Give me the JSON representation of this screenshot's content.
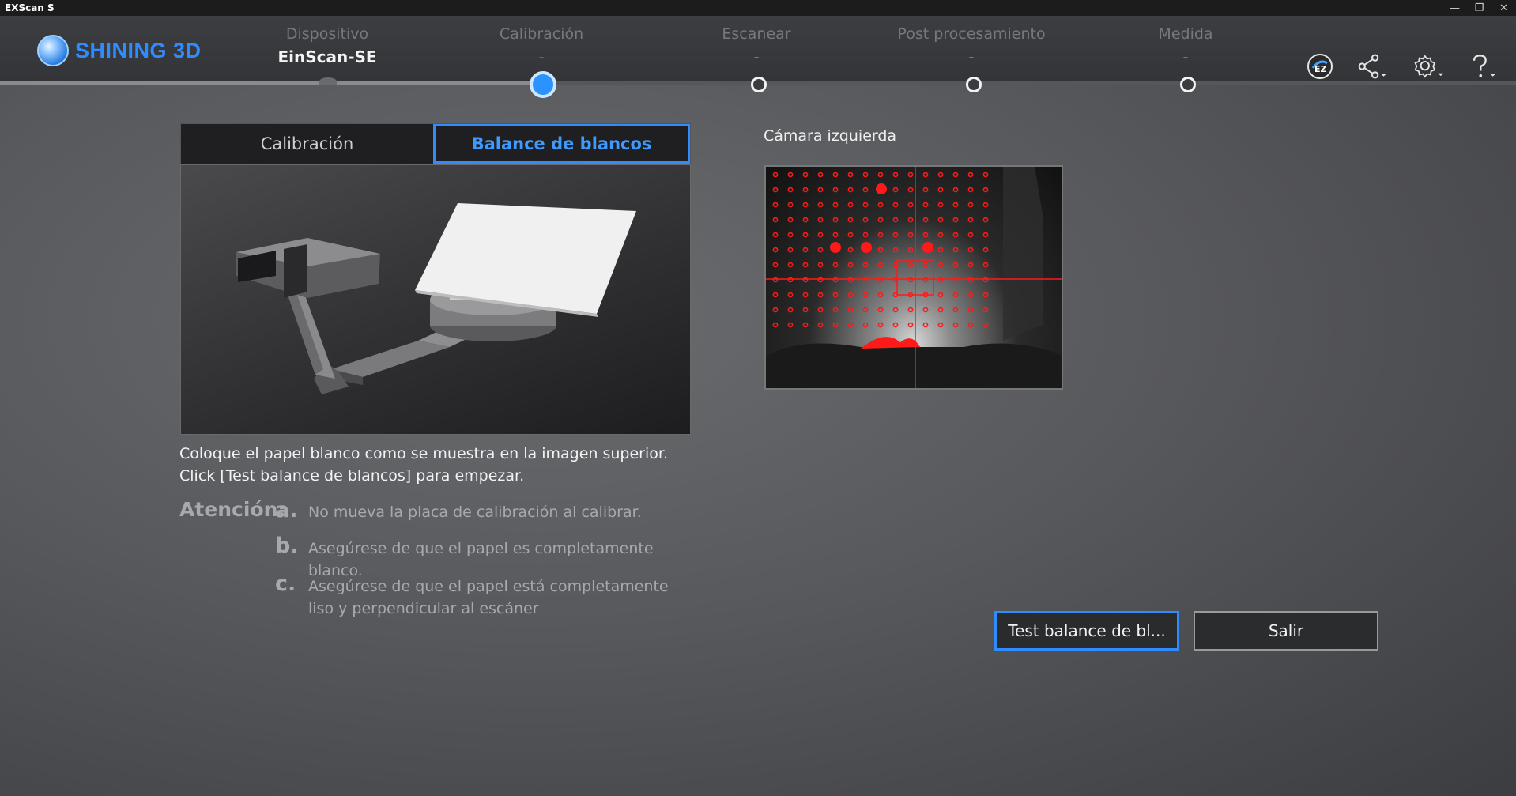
{
  "window": {
    "title": "EXScan S",
    "controls": [
      "minimize",
      "restore",
      "close"
    ]
  },
  "brand": {
    "name": "SHINING 3D"
  },
  "steps": [
    {
      "label": "Dispositivo",
      "value": "EinScan-SE"
    },
    {
      "label": "Calibración",
      "value": "-"
    },
    {
      "label": "Escanear",
      "value": "-"
    },
    {
      "label": "Post procesamiento",
      "value": "-"
    },
    {
      "label": "Medida",
      "value": "-"
    }
  ],
  "header_icons": [
    "ezmodel-icon",
    "share-icon",
    "settings-icon",
    "help-icon"
  ],
  "tabs": [
    {
      "label": "Calibración",
      "active": false
    },
    {
      "label": "Balance de blancos",
      "active": true
    }
  ],
  "instructions": {
    "line1": "Coloque el papel blanco como se muestra en la imagen superior.",
    "line2": "Click [Test balance de blancos] para empezar."
  },
  "attention": {
    "label": "Atención:",
    "items": [
      {
        "letter": "a.",
        "text": "No mueva la placa de calibración al calibrar."
      },
      {
        "letter": "b.",
        "text": "Asegúrese de que el papel es completamente blanco."
      },
      {
        "letter": "c.",
        "text": "Asegúrese de que el papel está completamente liso y perpendicular al escáner"
      }
    ]
  },
  "camera": {
    "label": "Cámara izquierda"
  },
  "buttons": {
    "test": "Test balance de bl...",
    "exit": "Salir"
  },
  "colors": {
    "accent": "#2f8cff",
    "marker_red": "#ff1a1a"
  }
}
